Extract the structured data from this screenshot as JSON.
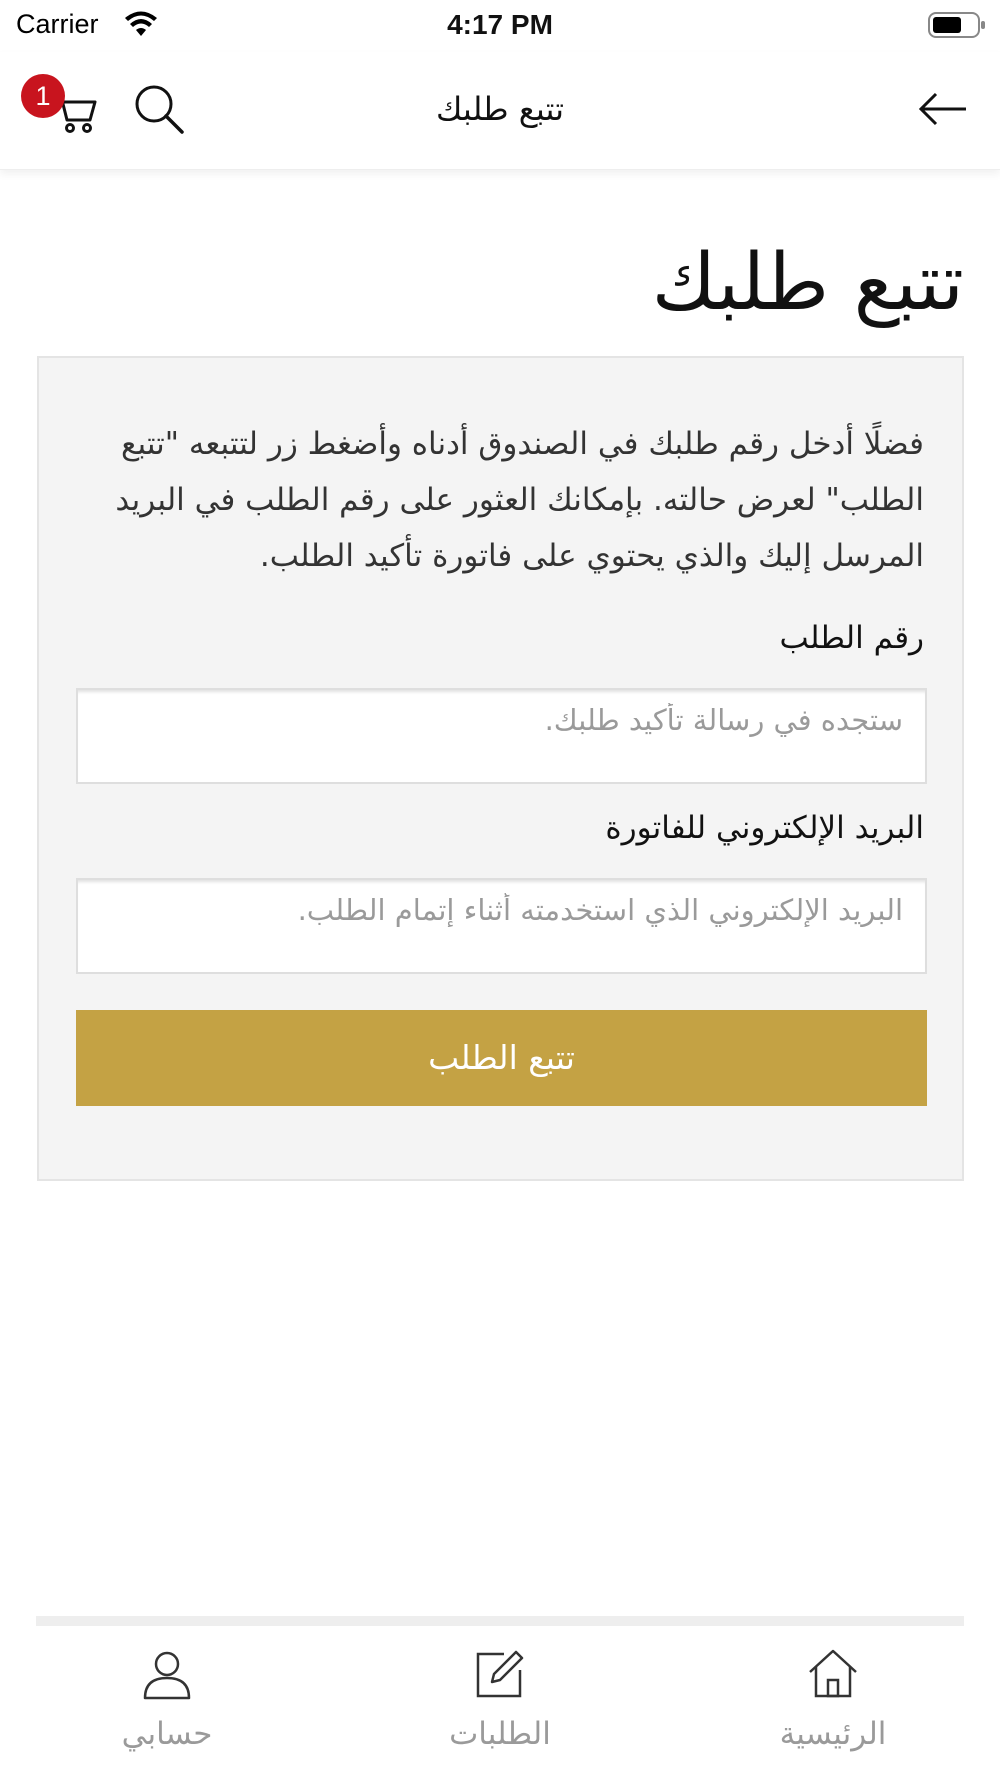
{
  "status_bar": {
    "carrier": "Carrier",
    "time": "4:17 PM"
  },
  "nav": {
    "title": "تتبع طلبك",
    "cart_count": "1",
    "icons": [
      "cart-icon",
      "search-icon",
      "back-arrow-icon"
    ]
  },
  "page": {
    "heading": "تتبع طلبك",
    "intro": "فضلًا أدخل رقم طلبك في الصندوق أدناه وأضغط زر لتتبعه \"تتبع الطلب\" لعرض حالته. بإمكانك العثور على رقم الطلب في البريد المرسل إليك والذي يحتوي على فاتورة تأكيد الطلب."
  },
  "form": {
    "order_number_label": "رقم الطلب",
    "order_number_placeholder": "ستجده في رسالة تأكيد طلبك.",
    "order_number_value": "",
    "email_label": "البريد الإلكتروني للفاتورة",
    "email_placeholder": "البريد الإلكتروني الذي استخدمته أثناء إتمام الطلب.",
    "email_value": "",
    "submit_label": "تتبع الطلب"
  },
  "tabs": [
    {
      "label": "حسابي",
      "icon": "user-icon"
    },
    {
      "label": "الطلبات",
      "icon": "edit-icon"
    },
    {
      "label": "الرئيسية",
      "icon": "home-icon"
    }
  ],
  "colors": {
    "accent": "#c4a244",
    "badge": "#c8141e",
    "card_bg": "#f4f4f4",
    "tab_label": "#9a9a9a"
  }
}
